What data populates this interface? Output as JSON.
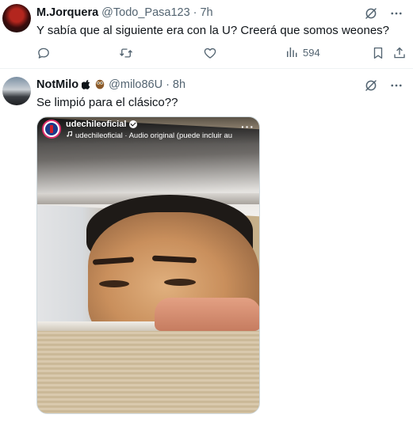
{
  "tweet1": {
    "name": "M.Jorquera",
    "handle": "@Todo_Pasa123",
    "separator": "·",
    "time": "7h",
    "text": "Y sabía que al siguiente era con la U? Creerá que somos weones?",
    "stats": {
      "views": "594"
    }
  },
  "tweet2": {
    "name": "NotMilo",
    "name_emojis": [
      "apple-icon",
      "owl-emoji"
    ],
    "handle": "@milo86U",
    "separator": "·",
    "time": "8h",
    "text": "Se limpió para el clásico??",
    "media": {
      "username": "udechileoficial",
      "audio": "udechileoficial · Audio original  (puede incluir au",
      "more": "···"
    }
  },
  "icons": [
    "grok-icon",
    "more-icon",
    "reply-icon",
    "retweet-icon",
    "like-icon",
    "views-icon",
    "bookmark-icon",
    "share-icon",
    "music-note-icon",
    "verified-icon"
  ],
  "colors": {
    "text": "#0f1419",
    "secondary": "#536471",
    "divider": "#eff3f4"
  }
}
